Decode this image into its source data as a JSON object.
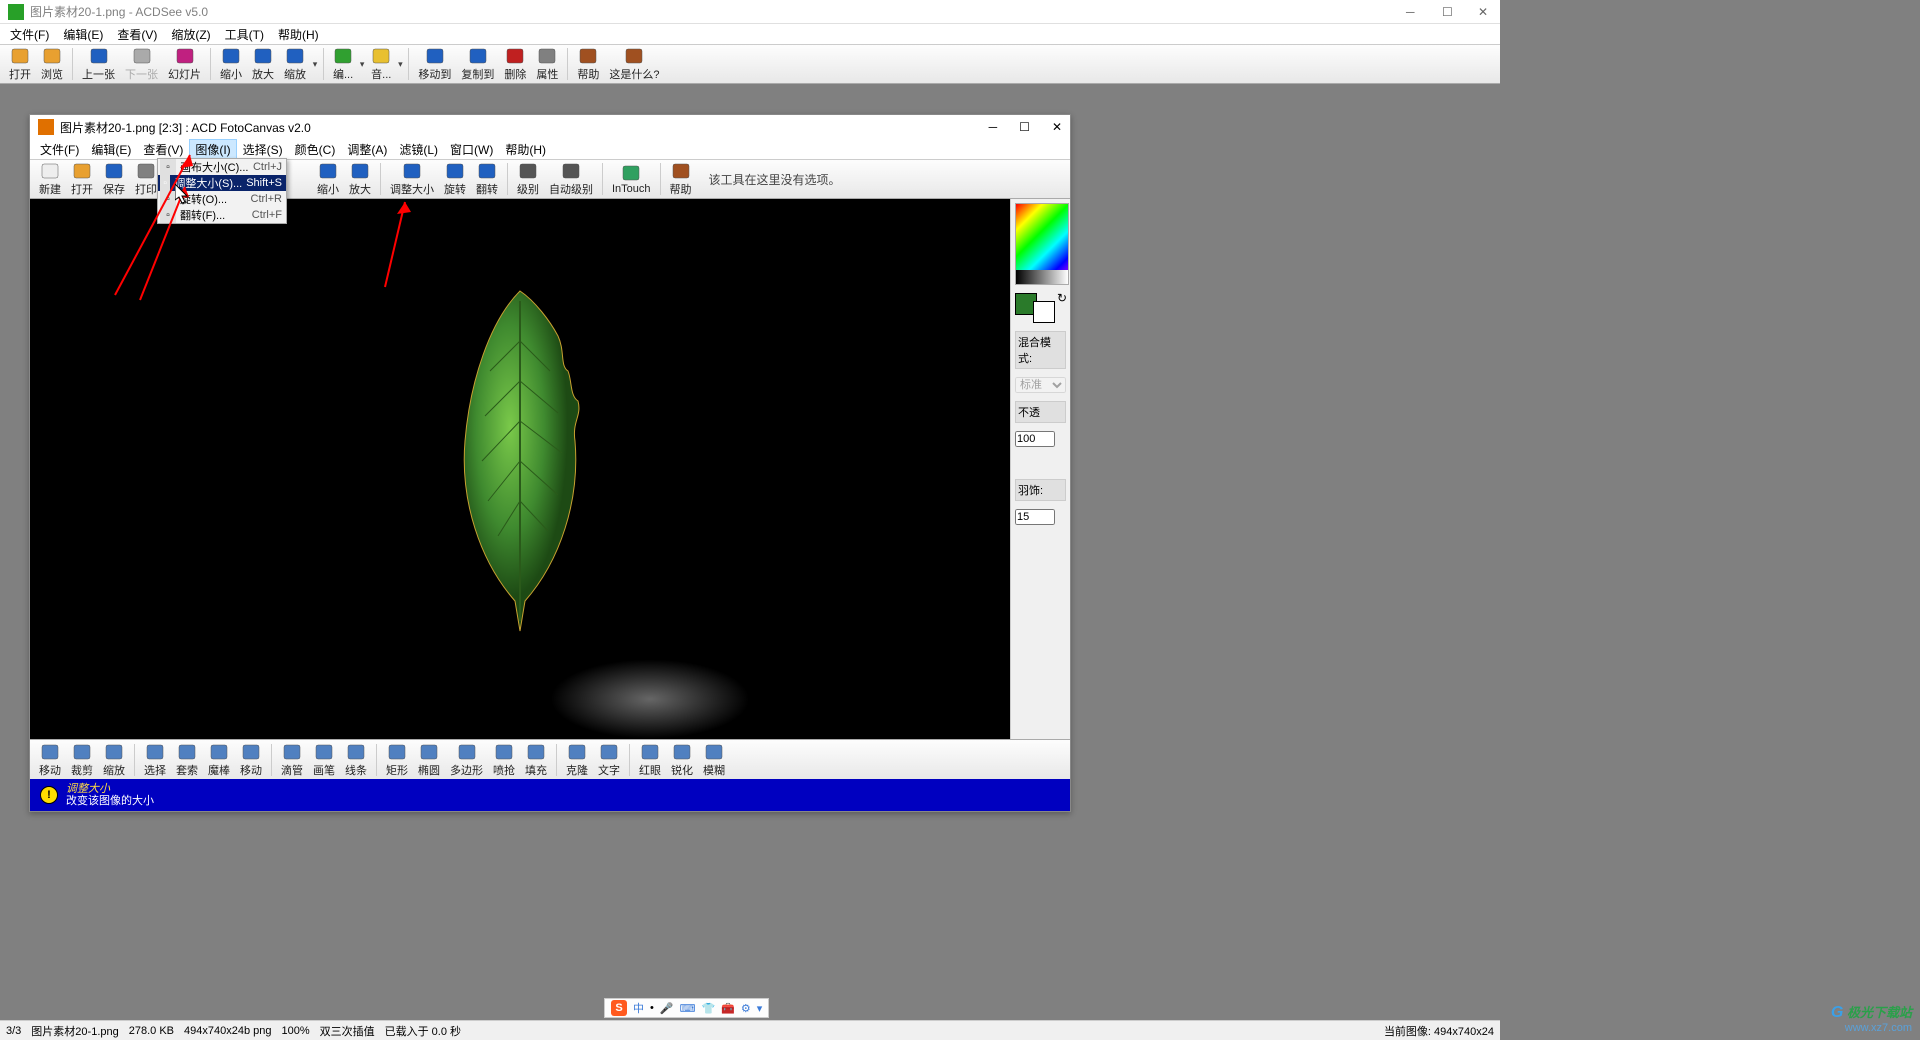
{
  "outer": {
    "title": "图片素材20-1.png - ACDSee v5.0",
    "menu": [
      "文件(F)",
      "编辑(E)",
      "查看(V)",
      "缩放(Z)",
      "工具(T)",
      "帮助(H)"
    ],
    "toolbar": [
      {
        "lbl": "打开",
        "icon": "folder-open-icon"
      },
      {
        "lbl": "浏览",
        "icon": "browse-icon"
      },
      {
        "sep": true
      },
      {
        "lbl": "上一张",
        "icon": "prev-icon"
      },
      {
        "lbl": "下一张",
        "icon": "next-icon",
        "disabled": true
      },
      {
        "lbl": "幻灯片",
        "icon": "slideshow-icon"
      },
      {
        "sep": true
      },
      {
        "lbl": "缩小",
        "icon": "zoom-out-icon"
      },
      {
        "lbl": "放大",
        "icon": "zoom-in-icon"
      },
      {
        "lbl": "缩放",
        "icon": "zoom-icon"
      },
      {
        "drop": true
      },
      {
        "sep": true
      },
      {
        "lbl": "编...",
        "icon": "edit-icon"
      },
      {
        "drop": true
      },
      {
        "lbl": "音...",
        "icon": "audio-icon"
      },
      {
        "drop": true
      },
      {
        "sep": true
      },
      {
        "lbl": "移动到",
        "icon": "move-icon"
      },
      {
        "lbl": "复制到",
        "icon": "copy-icon"
      },
      {
        "lbl": "删除",
        "icon": "delete-icon"
      },
      {
        "lbl": "属性",
        "icon": "properties-icon"
      },
      {
        "sep": true
      },
      {
        "lbl": "帮助",
        "icon": "help-icon"
      },
      {
        "lbl": "这是什么?",
        "icon": "whatsthis-icon"
      }
    ]
  },
  "inner": {
    "title": "图片素材20-1.png [2:3] : ACD FotoCanvas v2.0",
    "menu": [
      "文件(F)",
      "编辑(E)",
      "查看(V)",
      "图像(I)",
      "选择(S)",
      "颜色(C)",
      "调整(A)",
      "滤镜(L)",
      "窗口(W)",
      "帮助(H)"
    ],
    "menu_active_index": 3,
    "toolbar": [
      {
        "lbl": "新建",
        "icon": "new-icon"
      },
      {
        "lbl": "打开",
        "icon": "folder-open-icon"
      },
      {
        "lbl": "保存",
        "icon": "save-icon"
      },
      {
        "lbl": "打印",
        "icon": "print-icon"
      }
    ],
    "toolbar2": [
      {
        "lbl": "缩小",
        "icon": "zoom-out-icon"
      },
      {
        "lbl": "放大",
        "icon": "zoom-in-icon"
      },
      {
        "sep": true
      },
      {
        "lbl": "调整大小",
        "icon": "resize-icon"
      },
      {
        "lbl": "旋转",
        "icon": "rotate-icon"
      },
      {
        "lbl": "翻转",
        "icon": "flip-icon"
      },
      {
        "sep": true
      },
      {
        "lbl": "级别",
        "icon": "levels-icon"
      },
      {
        "lbl": "自动级别",
        "icon": "auto-levels-icon"
      },
      {
        "sep": true
      },
      {
        "lbl": "InTouch",
        "icon": "intouch-icon"
      },
      {
        "sep": true
      },
      {
        "lbl": "帮助",
        "icon": "help-icon"
      }
    ],
    "tool_hint": "该工具在这里没有选项。",
    "side": {
      "blend_label": "混合模式:",
      "blend_value": "标准",
      "opacity_label": "不透",
      "opacity_value": "100",
      "feather_label": "羽饰:",
      "feather_value": "15"
    },
    "palette": [
      {
        "lbl": "移动",
        "icon": "move-tool-icon"
      },
      {
        "lbl": "裁剪",
        "icon": "crop-tool-icon"
      },
      {
        "lbl": "缩放",
        "icon": "zoom-tool-icon"
      },
      {
        "sep": true
      },
      {
        "lbl": "选择",
        "icon": "select-tool-icon"
      },
      {
        "lbl": "套索",
        "icon": "lasso-tool-icon"
      },
      {
        "lbl": "魔棒",
        "icon": "wand-tool-icon"
      },
      {
        "lbl": "移动",
        "icon": "move2-tool-icon"
      },
      {
        "sep": true
      },
      {
        "lbl": "滴管",
        "icon": "eyedropper-icon"
      },
      {
        "lbl": "画笔",
        "icon": "brush-icon"
      },
      {
        "lbl": "线条",
        "icon": "line-icon"
      },
      {
        "sep": true
      },
      {
        "lbl": "矩形",
        "icon": "rect-icon"
      },
      {
        "lbl": "椭圆",
        "icon": "ellipse-icon"
      },
      {
        "lbl": "多边形",
        "icon": "polygon-icon"
      },
      {
        "lbl": "喷抢",
        "icon": "spray-icon"
      },
      {
        "lbl": "填充",
        "icon": "fill-icon"
      },
      {
        "sep": true
      },
      {
        "lbl": "克隆",
        "icon": "clone-icon"
      },
      {
        "lbl": "文字",
        "icon": "text-icon"
      },
      {
        "sep": true
      },
      {
        "lbl": "红眼",
        "icon": "redeye-icon"
      },
      {
        "lbl": "锐化",
        "icon": "sharpen-icon"
      },
      {
        "lbl": "模糊",
        "icon": "blur-icon"
      }
    ],
    "status_hint_title": "调整大小",
    "status_hint_desc": "改变该图像的大小"
  },
  "dropdown": [
    {
      "label": "画布大小(C)...",
      "shortcut": "Ctrl+J"
    },
    {
      "label": "调整大小(S)...",
      "shortcut": "Shift+S",
      "highlighted": true
    },
    {
      "label": "旋转(O)...",
      "shortcut": "Ctrl+R"
    },
    {
      "label": "翻转(F)...",
      "shortcut": "Ctrl+F"
    }
  ],
  "bottom_status": {
    "index": "3/3",
    "file": "图片素材20-1.png",
    "size": "278.0 KB",
    "dims": "494x740x24b png",
    "zoom": "100%",
    "interp": "双三次插值",
    "loadtime": "已载入于 0.0 秒",
    "right": "当前图像:  494x740x24"
  },
  "ime": {
    "icons": [
      "S",
      "中",
      "🎤",
      "🖥",
      "👕",
      "🧸",
      "⚙",
      "↓"
    ],
    "label": "中"
  },
  "watermark": {
    "line1": "极光下载站",
    "line2": "www.xz7.com"
  }
}
